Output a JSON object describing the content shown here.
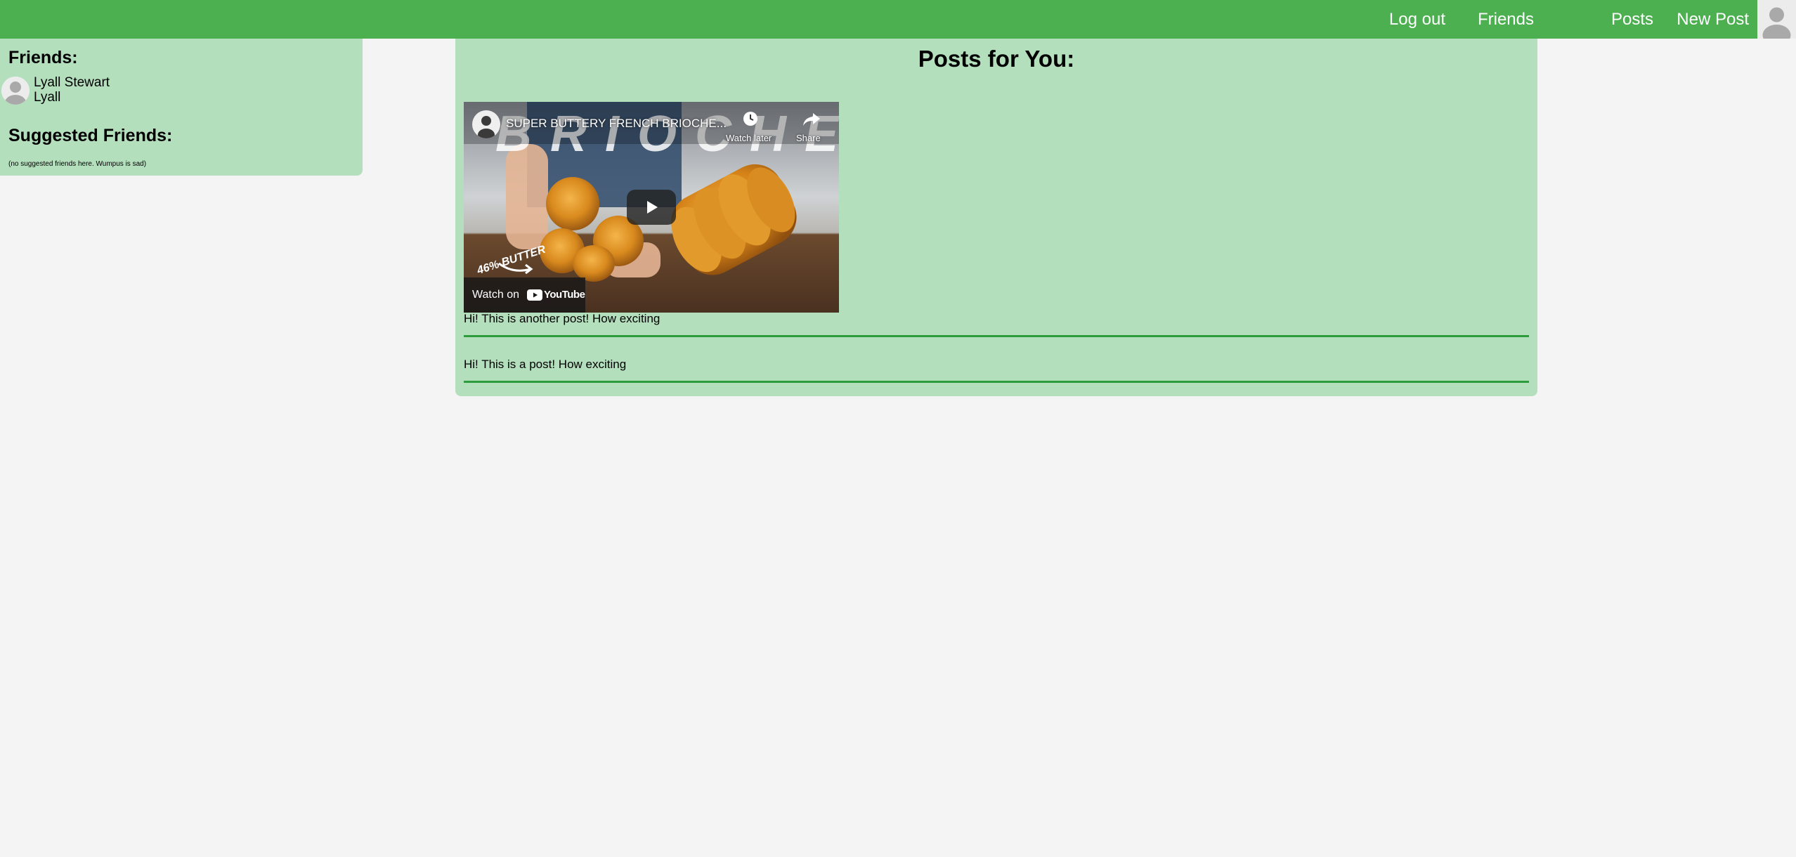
{
  "nav": {
    "logout": "Log out",
    "friends": "Friends",
    "posts": "Posts",
    "new_post": "New Post",
    "avatar_icon": "user-avatar-icon"
  },
  "sidebar": {
    "friends_heading": "Friends:",
    "friends": [
      {
        "name": "Lyall Stewart",
        "username": "Lyall",
        "avatar_icon": "user-avatar-icon"
      }
    ],
    "suggested_heading": "Suggested Friends:",
    "no_suggested": "(no suggested friends here. Wumpus is sad)"
  },
  "main": {
    "title": "Posts for You:",
    "posts": [
      {
        "text": "Hi! This is another post! How exciting",
        "video": {
          "title": "SUPER BUTTERY FRENCH BRIOCHE...",
          "thumbnail_text": "BRIOCHE",
          "overlay_badge": "46% BUTTER",
          "watch_later": "Watch later",
          "share": "Share",
          "watch_on": "Watch on",
          "brand": "YouTube"
        }
      },
      {
        "text": "Hi! This is a post! How exciting"
      }
    ]
  },
  "colors": {
    "nav_bg": "#4caf50",
    "panel_bg": "#b4dfbd",
    "page_bg": "#f4f4f4",
    "divider": "#2e9b3c",
    "youtube_red": "#ff0000"
  }
}
